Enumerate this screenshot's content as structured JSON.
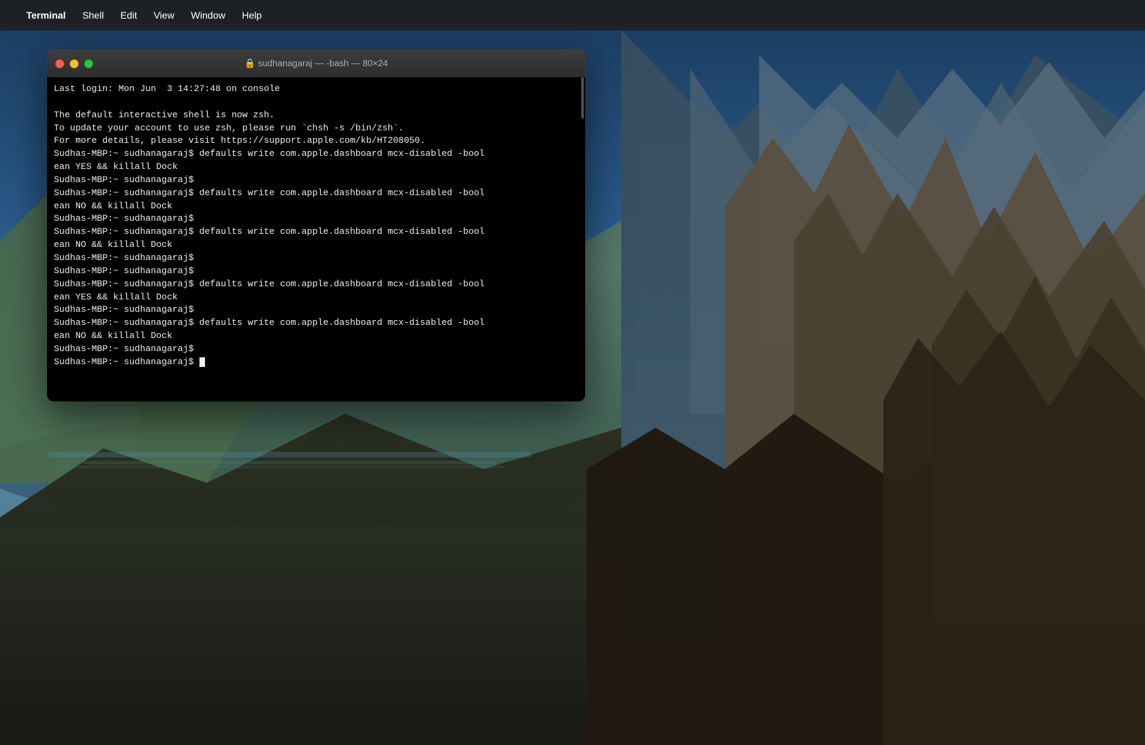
{
  "desktop": {
    "bg_description": "macOS Catalina mountain landscape"
  },
  "menubar": {
    "apple_symbol": "",
    "items": [
      {
        "id": "terminal",
        "label": "Terminal",
        "active": true
      },
      {
        "id": "shell",
        "label": "Shell",
        "active": false
      },
      {
        "id": "edit",
        "label": "Edit",
        "active": false
      },
      {
        "id": "view",
        "label": "View",
        "active": false
      },
      {
        "id": "window",
        "label": "Window",
        "active": false
      },
      {
        "id": "help",
        "label": "Help",
        "active": false
      }
    ]
  },
  "terminal": {
    "title": "🔒 sudhanagaraj — -bash — 80×24",
    "title_lock_icon": "🔒",
    "title_text": "sudhanagaraj — -bash — 80×24",
    "lines": [
      "Last login: Mon Jun  3 14:27:48 on console",
      "",
      "The default interactive shell is now zsh.",
      "To update your account to use zsh, please run `chsh -s /bin/zsh`.",
      "For more details, please visit https://support.apple.com/kb/HT208050.",
      "Sudhas-MBP:~ sudhanagaraj$ defaults write com.apple.dashboard mcx-disabled -bool",
      "ean YES && killall Dock",
      "Sudhas-MBP:~ sudhanagaraj$",
      "Sudhas-MBP:~ sudhanagaraj$ defaults write com.apple.dashboard mcx-disabled -bool",
      "ean NO && killall Dock",
      "Sudhas-MBP:~ sudhanagaraj$",
      "Sudhas-MBP:~ sudhanagaraj$ defaults write com.apple.dashboard mcx-disabled -bool",
      "ean NO && killall Dock",
      "Sudhas-MBP:~ sudhanagaraj$",
      "Sudhas-MBP:~ sudhanagaraj$",
      "Sudhas-MBP:~ sudhanagaraj$ defaults write com.apple.dashboard mcx-disabled -bool",
      "ean YES && killall Dock",
      "Sudhas-MBP:~ sudhanagaraj$",
      "Sudhas-MBP:~ sudhanagaraj$ defaults write com.apple.dashboard mcx-disabled -bool",
      "ean NO && killall Dock",
      "Sudhas-MBP:~ sudhanagaraj$",
      "Sudhas-MBP:~ sudhanagaraj$ "
    ],
    "prompt_label": "Sudhas-MBP:~ sudhanagaraj$ "
  }
}
